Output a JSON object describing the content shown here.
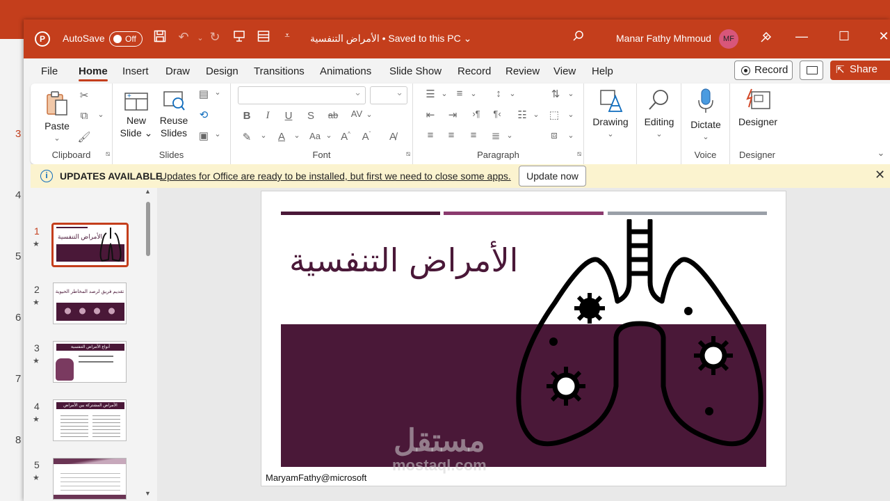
{
  "background_window": {
    "slide_numbers": [
      "3",
      "4",
      "5",
      "6",
      "7",
      "8"
    ]
  },
  "titlebar": {
    "autosave_label": "AutoSave",
    "autosave_state": "Off",
    "document_title": "الأمراض التنفسية • Saved to this PC ⌄",
    "user_name": "Manar Fathy Mhmoud",
    "user_initials": "MF"
  },
  "tabs": [
    "File",
    "Home",
    "Insert",
    "Draw",
    "Design",
    "Transitions",
    "Animations",
    "Slide Show",
    "Record",
    "Review",
    "View",
    "Help"
  ],
  "active_tab": "Home",
  "header_buttons": {
    "record": "Record",
    "share": "Share"
  },
  "ribbon": {
    "clipboard": {
      "paste": "Paste",
      "label": "Clipboard"
    },
    "slides": {
      "new_slide_line1": "New",
      "new_slide_line2": "Slide ⌄",
      "reuse_line1": "Reuse",
      "reuse_line2": "Slides",
      "label": "Slides"
    },
    "font": {
      "label": "Font"
    },
    "paragraph": {
      "label": "Paragraph"
    },
    "drawing": {
      "label": "Drawing"
    },
    "editing": {
      "label": "Editing"
    },
    "voice": {
      "dictate": "Dictate",
      "label": "Voice"
    },
    "designer": {
      "button": "Designer",
      "label": "Designer"
    }
  },
  "notification": {
    "title": "UPDATES AVAILABLE",
    "message": "Updates for Office are ready to be installed, but first we need to close some apps.",
    "button": "Update now"
  },
  "thumbnails": [
    {
      "number": "1",
      "title": "الأمراض التنفسية"
    },
    {
      "number": "2",
      "title": "تقديم فريق لرصد المخاطر الحيوية"
    },
    {
      "number": "3",
      "title": "أنواع الأمراض التنفسية"
    },
    {
      "number": "4",
      "title": "الأمراض المشتركة بين الأمراض التنفسية"
    },
    {
      "number": "5",
      "title": ""
    }
  ],
  "slide": {
    "title": "الأمراض التنفسية",
    "footer": "MaryamFathy@microsoft",
    "bar_colors": [
      "#4a1838",
      "#8b3a6e",
      "#9aa0a8"
    ],
    "title_color": "#4a1838",
    "block_color": "#4a1838"
  },
  "watermark": {
    "arabic": "مستقل",
    "latin": "mostaql.com"
  },
  "colors": {
    "accent": "#c43e1c",
    "info_blue": "#0f6cbd",
    "notif_bg": "#fbf3cf"
  }
}
